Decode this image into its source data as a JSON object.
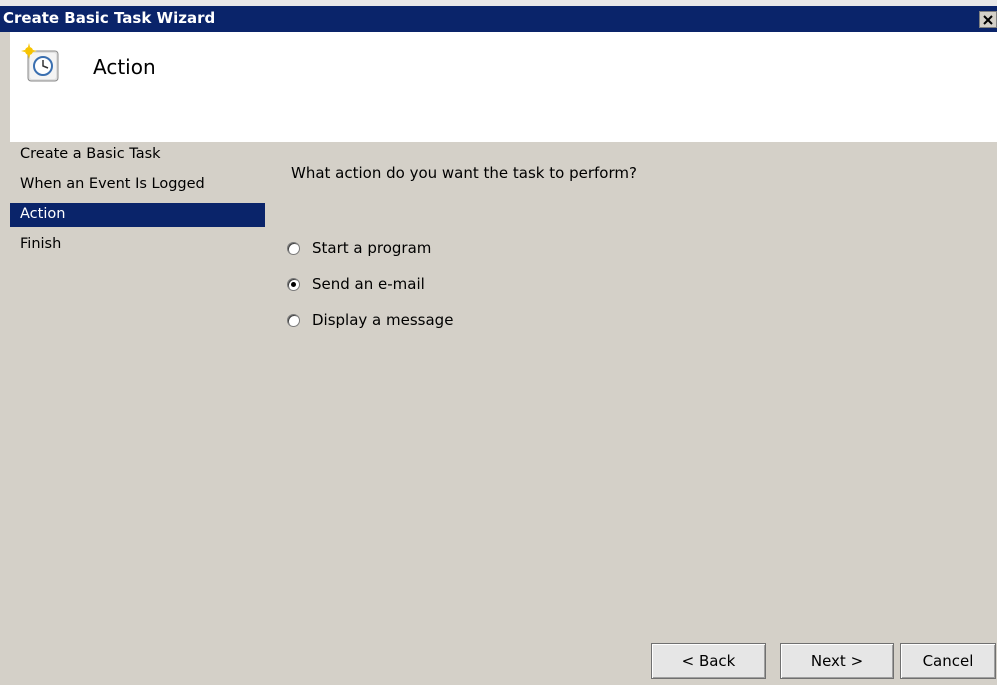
{
  "window": {
    "title": "Create Basic Task Wizard",
    "close_glyph": "✕"
  },
  "header": {
    "title": "Action",
    "icon": "scheduled-task-clock-icon"
  },
  "sidebar": {
    "steps": [
      {
        "label": "Create a Basic Task",
        "active": false
      },
      {
        "label": "When an Event Is Logged",
        "active": false
      },
      {
        "label": "Action",
        "active": true
      },
      {
        "label": "Finish",
        "active": false
      }
    ]
  },
  "main": {
    "question": "What action do you want the task to perform?",
    "options": [
      {
        "label": "Start a program",
        "checked": false
      },
      {
        "label": "Send an e-mail",
        "checked": true
      },
      {
        "label": "Display a message",
        "checked": false
      }
    ]
  },
  "buttons": {
    "back": "< Back",
    "next": "Next >",
    "cancel": "Cancel"
  },
  "colors": {
    "title_bar": "#0a246a",
    "selected_step": "#0a246a",
    "dialog_background": "#d4d0c8",
    "header_background": "#ffffff"
  }
}
